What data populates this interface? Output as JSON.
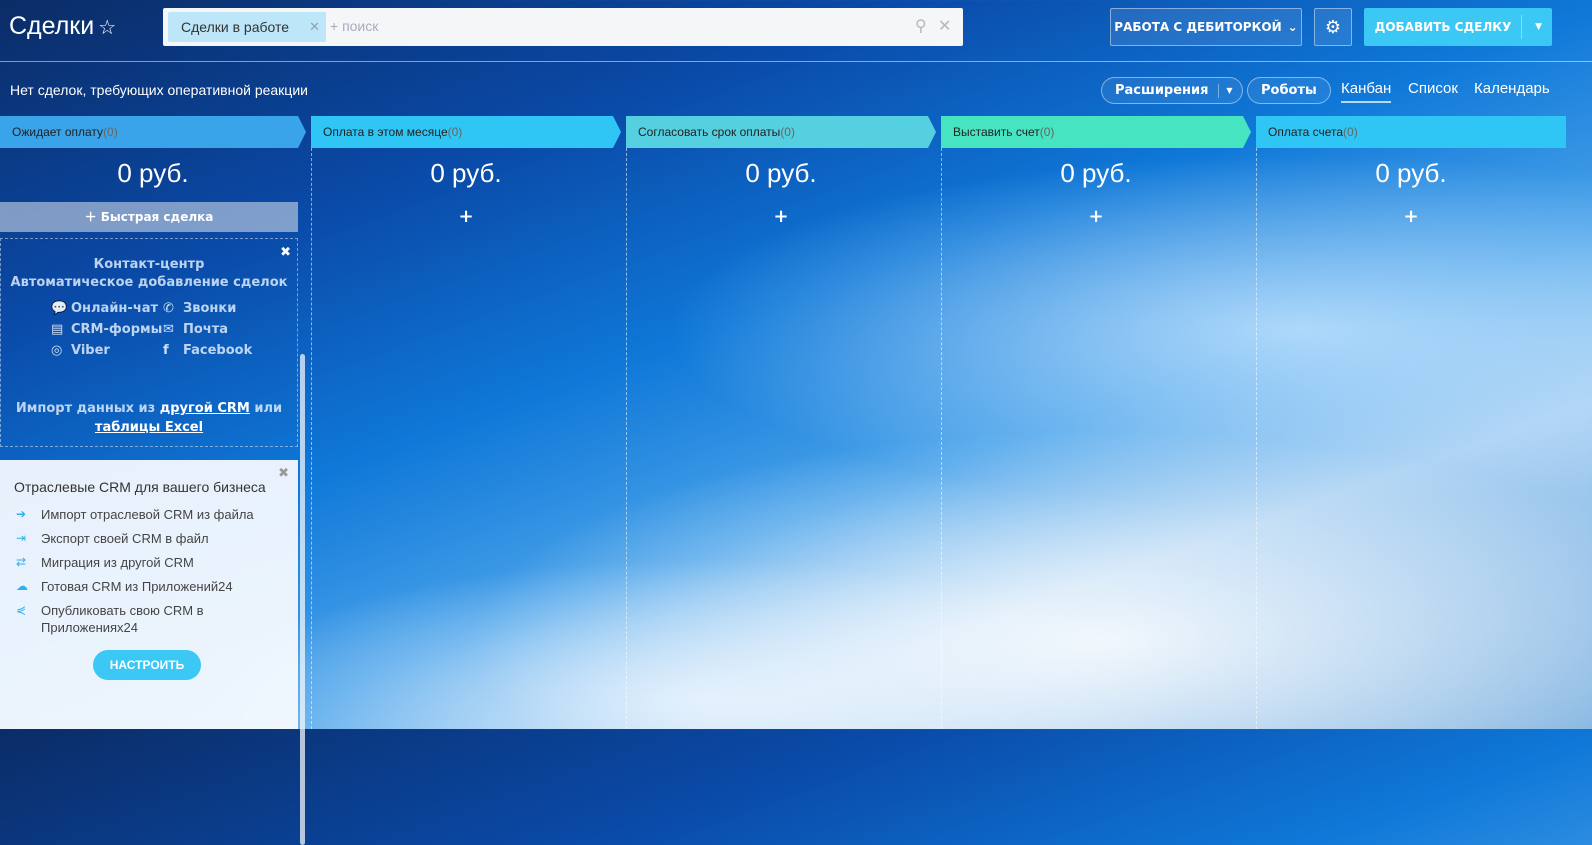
{
  "header": {
    "title": "Сделки",
    "star_icon": "star-icon",
    "filter_chip": "Сделки в работе",
    "search_placeholder": "+ поиск",
    "debt_button": "РАБОТА С ДЕБИТОРКОЙ",
    "add_button": "ДОБАВИТЬ СДЕЛКУ"
  },
  "toolbar": {
    "notice": "Нет сделок, требующих оперативной реакции",
    "extensions": "Расширения",
    "robots": "Роботы",
    "views": [
      "Канбан",
      "Список",
      "Календарь"
    ],
    "active_view": "Канбан"
  },
  "stages": [
    {
      "name": "Ожидает оплату",
      "count": "(0)",
      "sum": "0 руб.",
      "color": "#3aa4ea"
    },
    {
      "name": "Оплата в этом месяце",
      "count": "(0)",
      "sum": "0 руб.",
      "color": "#2fc6f6"
    },
    {
      "name": "Согласовать срок оплаты",
      "count": "(0)",
      "sum": "0 руб.",
      "color": "#55d0e0"
    },
    {
      "name": "Выставить счет",
      "count": "(0)",
      "sum": "0 руб.",
      "color": "#47e4c2"
    },
    {
      "name": "Оплата счета",
      "count": "(0)",
      "sum": "0 руб.",
      "color": "#2fc6f6"
    }
  ],
  "quick_deal": "Быстрая сделка",
  "contact_center": {
    "title": "Контакт-центр",
    "subtitle": "Автоматическое добавление сделок",
    "channels": [
      "Онлайн-чат",
      "Звонки",
      "CRM-формы",
      "Почта",
      "Viber",
      "Facebook"
    ],
    "import_prefix": "Импорт данных из",
    "import_link1": "другой CRM",
    "import_mid": "или",
    "import_link2": "таблицы Excel"
  },
  "industry": {
    "title": "Отраслевые CRM для вашего бизнеса",
    "items": [
      "Импорт отраслевой CRM из файла",
      "Экспорт своей CRM в файл",
      "Миграция из другой CRM",
      "Готовая CRM из Приложений24",
      "Опубликовать свою CRM в Приложениях24"
    ],
    "button": "НАСТРОИТЬ"
  }
}
